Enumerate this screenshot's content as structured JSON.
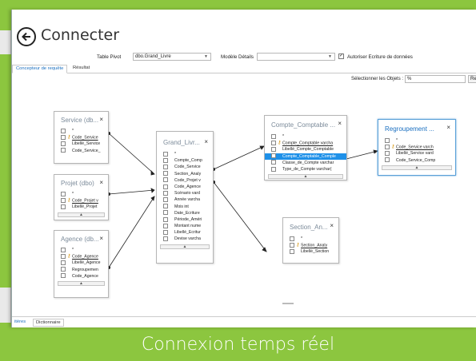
{
  "window": {
    "title": "Connecter"
  },
  "toolbar": {
    "table_pivot_label": "Table Pivot",
    "table_pivot_value": "dbo.Grand_Livre",
    "modele_label": "Modèle Détails",
    "modele_value": "",
    "autoriser_label": "Autoriser Ecriture de données",
    "autoriser_checked": true
  },
  "tabs": [
    {
      "label": "Concepteur de requête",
      "active": true
    },
    {
      "label": "Résultat",
      "active": false
    }
  ],
  "objects": {
    "label": "Sélectionner les Objets :",
    "value": "%",
    "button_fragment": "Re"
  },
  "tables": {
    "service": {
      "title": "Service (db...",
      "rows": [
        {
          "text": "*",
          "key": false,
          "underline": false
        },
        {
          "text": "Code_Service",
          "key": true,
          "underline": true
        },
        {
          "text": "Libellé_Service",
          "key": false,
          "underline": false
        },
        {
          "text": "Code_Service_",
          "key": false,
          "underline": false
        }
      ]
    },
    "projet": {
      "title": "Projet (dbo)",
      "rows": [
        {
          "text": "*",
          "key": false,
          "underline": false
        },
        {
          "text": "Code_Projet v",
          "key": true,
          "underline": true
        },
        {
          "text": "Libellé_Projet",
          "key": false,
          "underline": false
        }
      ]
    },
    "agence": {
      "title": "Agence (db...",
      "rows": [
        {
          "text": "*",
          "key": false,
          "underline": false
        },
        {
          "text": "Code_Agence",
          "key": true,
          "underline": true
        },
        {
          "text": "Libellé_Agence",
          "key": false,
          "underline": false
        },
        {
          "text": "Regroupemen",
          "key": false,
          "underline": false
        },
        {
          "text": "Code_Agence",
          "key": false,
          "underline": false
        }
      ]
    },
    "grand_livre": {
      "title": "Grand_Livr...",
      "rows": [
        {
          "text": "*"
        },
        {
          "text": "Compte_Comp"
        },
        {
          "text": "Code_Service"
        },
        {
          "text": "Section_Analy"
        },
        {
          "text": "Code_Projet v"
        },
        {
          "text": "Code_Agence"
        },
        {
          "text": "Scénario vard"
        },
        {
          "text": "Année varcha"
        },
        {
          "text": "Mois int"
        },
        {
          "text": "Date_Ecriture"
        },
        {
          "text": "Période_Améri"
        },
        {
          "text": "Montant nume"
        },
        {
          "text": "Libellé_Ecritur"
        },
        {
          "text": "Devise varcha"
        }
      ]
    },
    "compte": {
      "title": "Compte_Comptable ...",
      "rows": [
        {
          "text": "*",
          "key": false,
          "underline": false,
          "hl": false
        },
        {
          "text": "Compte_Comptable varcha",
          "key": true,
          "underline": true,
          "hl": false
        },
        {
          "text": "Libellé_Compte_Comptable",
          "key": false,
          "underline": false,
          "hl": false
        },
        {
          "text": "Compte_Comptable_Comple",
          "key": false,
          "underline": false,
          "hl": true
        },
        {
          "text": "Classe_de_Compte varchar",
          "key": false,
          "underline": false,
          "hl": false
        },
        {
          "text": "Type_de_Compte varchar(",
          "key": false,
          "underline": false,
          "hl": false
        }
      ]
    },
    "section": {
      "title": "Section_An...",
      "rows": [
        {
          "text": "*",
          "key": false,
          "underline": false
        },
        {
          "text": "Section_Analy",
          "key": true,
          "underline": true
        },
        {
          "text": "Libellé_Section",
          "key": false,
          "underline": false
        }
      ]
    },
    "regroupement": {
      "title": "Regroupement ...",
      "rows": [
        {
          "text": "*",
          "key": false,
          "underline": false
        },
        {
          "text": "Code_Service varch",
          "key": true,
          "underline": true
        },
        {
          "text": "Libellé_Service vard",
          "key": false,
          "underline": false
        },
        {
          "text": "Code_Service_Comp",
          "key": false,
          "underline": false
        }
      ]
    }
  },
  "bottom_tabs": [
    {
      "label": "itères",
      "active": true
    },
    {
      "label": "Dictionnaire",
      "active": false
    }
  ],
  "caption": "Connexion temps réel",
  "colors": {
    "frame_green": "#8cc63f",
    "selection_blue": "#1e90e8",
    "link_blue": "#1a6fc0"
  }
}
